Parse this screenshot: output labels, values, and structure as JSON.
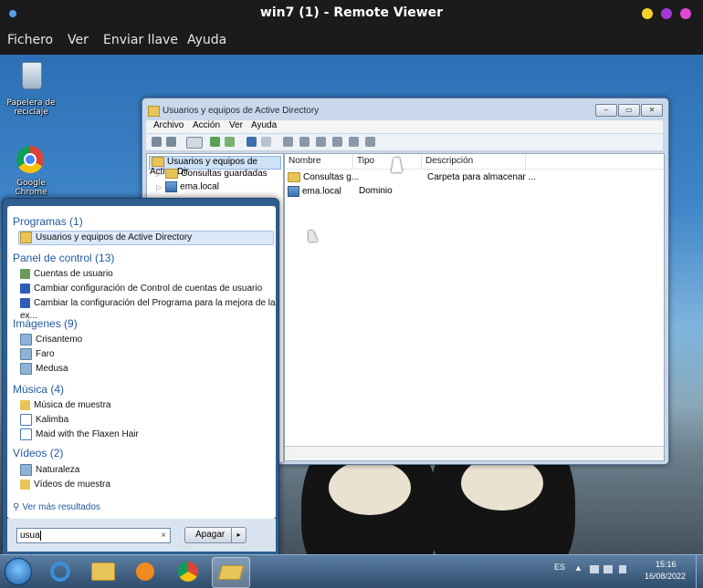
{
  "viewer": {
    "title": "win7 (1) - Remote Viewer",
    "menu": [
      "Fichero",
      "Ver",
      "Enviar llave",
      "Ayuda"
    ],
    "colors": {
      "dot_left": "#5aa0e6",
      "dot_yellow": "#f4d12a",
      "dot_purple": "#a43ad6",
      "dot_pink": "#e04ad0"
    }
  },
  "desktop": {
    "icons": [
      {
        "label": "Papelera de reciclaje",
        "icon": "recycle-bin-icon"
      },
      {
        "label": "Google Chrome",
        "icon": "chrome-icon"
      }
    ]
  },
  "ad_window": {
    "title": "Usuarios y equipos de Active Directory",
    "menu": [
      "Archivo",
      "Acción",
      "Ver",
      "Ayuda"
    ],
    "tree": [
      {
        "label": "Usuarios y equipos de Active Dir"
      },
      {
        "label": "Consultas guardadas"
      },
      {
        "label": "ema.local"
      }
    ],
    "columns": [
      "Nombre",
      "Tipo",
      "Descripción"
    ],
    "rows": [
      {
        "name": "Consultas g...",
        "type": "",
        "desc": "Carpeta para almacenar ..."
      },
      {
        "name": "ema.local",
        "type": "Dominio",
        "desc": ""
      }
    ]
  },
  "start_menu": {
    "groups": [
      {
        "title": "Programas (1)",
        "items": [
          "Usuarios y equipos de Active Directory"
        ]
      },
      {
        "title": "Panel de control (13)",
        "items": [
          "Cuentas de usuario",
          "Cambiar configuración de Control de cuentas de usuario",
          "Cambiar la configuración del Programa para la mejora de la ex..."
        ]
      },
      {
        "title": "Imágenes (9)",
        "items": [
          "Crisantemo",
          "Faro",
          "Medusa"
        ]
      },
      {
        "title": "Música (4)",
        "items": [
          "Música de muestra",
          "Kalimba",
          "Maid with the Flaxen Hair"
        ]
      },
      {
        "title": "Vídeos (2)",
        "items": [
          "Naturaleza",
          "Vídeos de muestra"
        ]
      }
    ],
    "more_results": "Ver más resultados",
    "search_value": "usua",
    "shutdown_label": "Apagar"
  },
  "taskbar": {
    "apps": [
      "start-orb-icon",
      "internet-explorer-icon",
      "explorer-icon",
      "media-player-icon",
      "chrome-icon",
      "active-directory-icon"
    ],
    "lang": "ES",
    "time": "15:16",
    "date": "16/08/2022"
  }
}
